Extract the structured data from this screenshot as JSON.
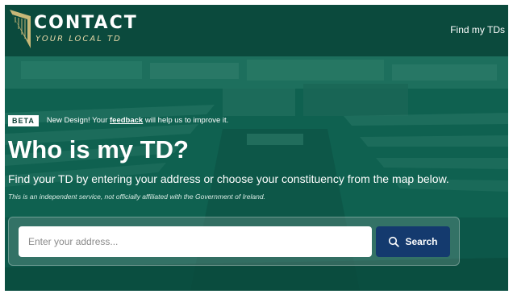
{
  "brand": {
    "title": "CONTACT",
    "subtitle": "YOUR LOCAL TD",
    "logo_icon": "harp-wedge-icon",
    "accent": "#c8b878"
  },
  "nav": {
    "find_tds": "Find my TDs"
  },
  "beta": {
    "badge": "BETA",
    "text_before": "New Design! Your ",
    "link": "feedback",
    "text_after": " will help us to improve it."
  },
  "hero": {
    "title": "Who is my TD?",
    "description": "Find your TD by entering your address or choose your constituency from the map below.",
    "note": "This is an independent service, not officially affiliated with the Government of Ireland."
  },
  "search": {
    "placeholder": "Enter your address...",
    "value": "",
    "button_label": "Search",
    "button_icon": "search-icon"
  },
  "colors": {
    "header": "#0b4a3d",
    "overlay": "#0f6150",
    "button": "#143a6e"
  }
}
